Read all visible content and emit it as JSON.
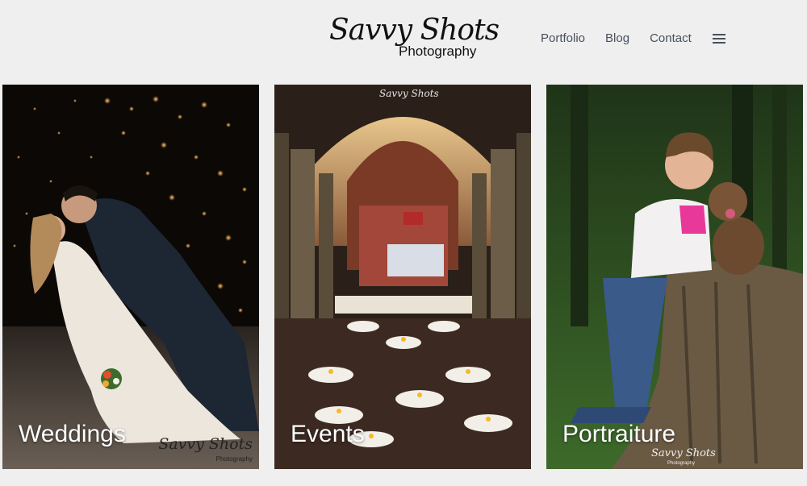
{
  "brand": {
    "script": "Savvy Shots",
    "sub": "Photography"
  },
  "nav": {
    "items": [
      {
        "label": "Portfolio"
      },
      {
        "label": "Blog"
      },
      {
        "label": "Contact"
      }
    ],
    "menu_icon": "hamburger-icon"
  },
  "cards": [
    {
      "label": "Weddings",
      "watermark": "Savvy Shots",
      "watermark_sub": "Photography"
    },
    {
      "label": "Events",
      "watermark": "Savvy Shots"
    },
    {
      "label": "Portraiture",
      "watermark": "Savvy Shots",
      "watermark_sub": "Photography"
    }
  ],
  "colors": {
    "background": "#efefef",
    "nav_text": "#48505e"
  }
}
